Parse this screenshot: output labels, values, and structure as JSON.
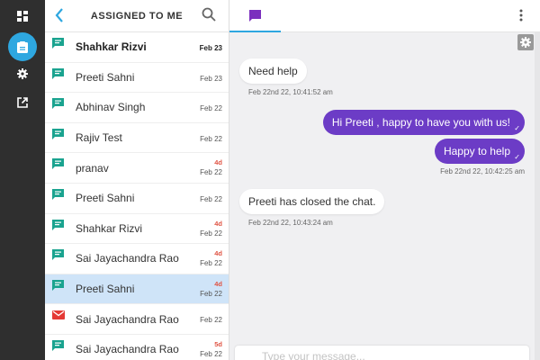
{
  "sidebar": {
    "items": [
      {
        "icon": "dashboard-icon"
      },
      {
        "icon": "conversations-icon",
        "active": true
      },
      {
        "icon": "gear-icon"
      },
      {
        "icon": "external-link-icon"
      }
    ]
  },
  "list_header": {
    "title": "ASSIGNED TO ME"
  },
  "conversations": [
    {
      "name": "Shahkar Rizvi",
      "date": "Feb 23",
      "age": "",
      "bold": true,
      "icon": "chat-icon"
    },
    {
      "name": "Preeti Sahni",
      "date": "Feb 23",
      "age": "",
      "bold": false,
      "icon": "chat-icon"
    },
    {
      "name": "Abhinav Singh",
      "date": "Feb 22",
      "age": "",
      "bold": false,
      "icon": "chat-icon"
    },
    {
      "name": "Rajiv Test",
      "date": "Feb 22",
      "age": "",
      "bold": false,
      "icon": "chat-icon"
    },
    {
      "name": "pranav",
      "date": "Feb 22",
      "age": "4d",
      "bold": false,
      "icon": "chat-icon"
    },
    {
      "name": "Preeti Sahni",
      "date": "Feb 22",
      "age": "",
      "bold": false,
      "icon": "chat-icon"
    },
    {
      "name": "Shahkar Rizvi",
      "date": "Feb 22",
      "age": "4d",
      "bold": false,
      "icon": "chat-icon"
    },
    {
      "name": "Sai Jayachandra Rao",
      "date": "Feb 22",
      "age": "4d",
      "bold": false,
      "icon": "chat-icon"
    },
    {
      "name": "Preeti Sahni",
      "date": "Feb 22",
      "age": "4d",
      "bold": false,
      "icon": "chat-icon",
      "selected": true
    },
    {
      "name": "Sai Jayachandra Rao",
      "date": "Feb 22",
      "age": "",
      "bold": false,
      "icon": "email-icon"
    },
    {
      "name": "Sai Jayachandra Rao",
      "date": "Feb 22",
      "age": "5d",
      "bold": false,
      "icon": "chat-icon"
    }
  ],
  "messages": [
    {
      "direction": "in",
      "text": "Need help"
    },
    {
      "type": "timestamp",
      "text": "Feb 22nd 22, 10:41:52 am"
    },
    {
      "direction": "out",
      "text": "Hi Preeti , happy to have you with us!",
      "tick": "✓"
    },
    {
      "direction": "out",
      "text": "Happy to help",
      "tick": "✓"
    },
    {
      "type": "timestamp",
      "text": "Feb 22nd 22, 10:42:25 am"
    },
    {
      "direction": "in",
      "text": "Preeti has closed the chat."
    },
    {
      "type": "timestamp",
      "text": "Feb 22nd 22, 10:43:24 am"
    }
  ],
  "composer": {
    "placeholder": "Type your message..."
  },
  "colors": {
    "accent": "#2ea7e0",
    "outgoing_bubble": "#6c3cc6",
    "chat_tab_icon": "#7b2fbe",
    "chat_list_icon": "#1aa38f",
    "email_icon": "#e53935",
    "selected_row": "#cfe4f8",
    "rail": "#2f2f2f"
  }
}
